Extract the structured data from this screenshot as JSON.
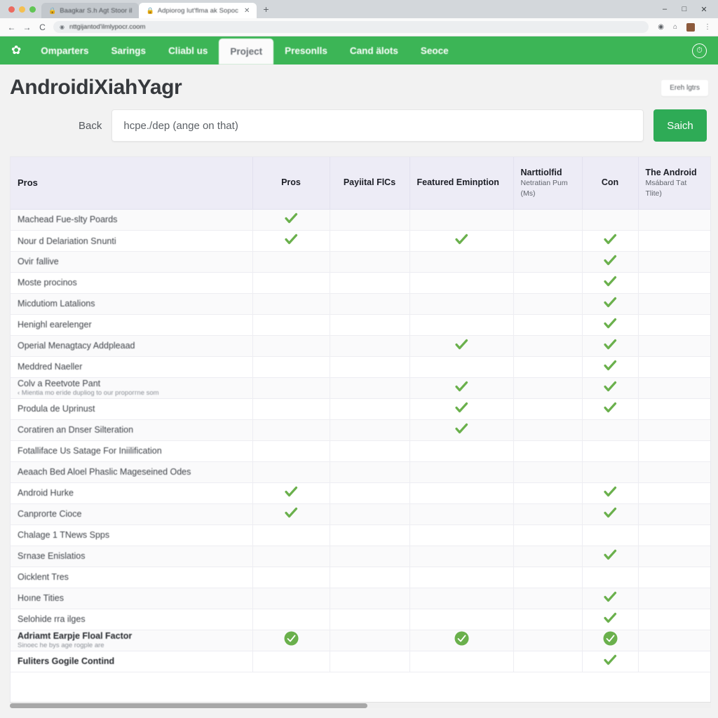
{
  "browser": {
    "tabs": [
      {
        "title": "Baagkar S.h Agt Stoor il",
        "icon": "lock-icon",
        "active": false
      },
      {
        "title": "Adpiorog lut'flma ak Sopoc",
        "icon": "lock-icon",
        "active": true
      }
    ],
    "new_tab_label": "+",
    "window_controls": {
      "minimize": "–",
      "maximize": "□",
      "close": "✕"
    },
    "nav": {
      "back": "←",
      "forward": "→",
      "reload": "C"
    },
    "url": "nttgijantod'ilmlypocr.coom",
    "url_icon": "info-icon",
    "toolbar_icons": [
      "record-icon",
      "home-icon",
      "extension-icon",
      "menu-icon"
    ]
  },
  "sitenav": {
    "logo_icon": "leaf-logo-icon",
    "items": [
      {
        "label": "Omparters",
        "current": false
      },
      {
        "label": "Sarings",
        "current": false
      },
      {
        "label": "Cliabl us",
        "current": false
      },
      {
        "label": "Project",
        "current": true
      },
      {
        "label": "Presonlls",
        "current": false
      },
      {
        "label": "Cand älots",
        "current": false
      },
      {
        "label": "Seoce",
        "current": false
      }
    ],
    "right_icon": "clock-circle-icon"
  },
  "header": {
    "title": "AndroidiXiahYagr",
    "chip_label": "Ereh lgtrs"
  },
  "search": {
    "back_label": "Back",
    "value": "hсpe./dep (ange on that)",
    "placeholder": "hсpe./dep (ange on that)",
    "button_label": "Saich"
  },
  "table": {
    "columns": [
      {
        "main": "Pros",
        "sub": ""
      },
      {
        "main": "Pros",
        "sub": ""
      },
      {
        "main": "Payiital FlCs",
        "sub": ""
      },
      {
        "main": "Featured Eminption",
        "sub": ""
      },
      {
        "main": "Narttiolfid",
        "sub": "Netratian Pum (Mѕ)"
      },
      {
        "main": "Con",
        "sub": ""
      },
      {
        "main": "The Android",
        "sub": "Mѕábard Tаt Tlite)"
      }
    ],
    "rows": [
      {
        "label": "Machead Fue-sltу Poards",
        "sub": "",
        "bold": false,
        "marks": [
          true,
          false,
          false,
          false,
          false,
          false
        ]
      },
      {
        "label": "Nour d Delariation Sոunti",
        "sub": "",
        "bold": false,
        "marks": [
          true,
          false,
          true,
          false,
          true,
          false
        ]
      },
      {
        "label": "Oviг fallive",
        "sub": "",
        "bold": false,
        "marks": [
          false,
          false,
          false,
          false,
          true,
          false
        ]
      },
      {
        "label": "Moste procinos",
        "sub": "",
        "bold": false,
        "marks": [
          false,
          false,
          false,
          false,
          true,
          false
        ]
      },
      {
        "label": "Micdutiom Latalions",
        "sub": "",
        "bold": false,
        "marks": [
          false,
          false,
          false,
          false,
          true,
          false
        ]
      },
      {
        "label": "Henighl earelenger",
        "sub": "",
        "bold": false,
        "marks": [
          false,
          false,
          false,
          false,
          true,
          false
        ]
      },
      {
        "label": "Operial Menagtacy Addpleaad",
        "sub": "",
        "bold": false,
        "marks": [
          false,
          false,
          true,
          false,
          true,
          false
        ]
      },
      {
        "label": "Meddred Naeller",
        "sub": "",
        "bold": false,
        "marks": [
          false,
          false,
          false,
          false,
          true,
          false
        ]
      },
      {
        "label": "Colv a Reetvote Pant",
        "sub": "‹ Mientia mo eгіde dupliog to our propoггne ѕom",
        "bold": false,
        "marks": [
          false,
          false,
          true,
          false,
          true,
          false
        ]
      },
      {
        "label": "Produla de Uprinust",
        "sub": "",
        "bold": false,
        "marks": [
          false,
          false,
          true,
          false,
          true,
          false
        ]
      },
      {
        "label": "Coгatiren an Dnser Silteration",
        "sub": "",
        "bold": false,
        "marks": [
          false,
          false,
          true,
          false,
          false,
          false
        ]
      },
      {
        "label": "Fotallіfаce Us Satage For Iniilification",
        "sub": "",
        "bold": false,
        "marks": [
          false,
          false,
          false,
          false,
          false,
          false
        ]
      },
      {
        "label": "Aеaach Bed Aloеl Phaslic Mageseined Odes",
        "sub": "",
        "bold": false,
        "marks": [
          false,
          false,
          false,
          false,
          false,
          false
        ]
      },
      {
        "label": "Android Hurke",
        "sub": "",
        "bold": false,
        "marks": [
          true,
          false,
          false,
          false,
          true,
          false
        ]
      },
      {
        "label": "Canproгte Cіoce",
        "sub": "",
        "bold": false,
        "marks": [
          true,
          false,
          false,
          false,
          true,
          false
        ]
      },
      {
        "label": "Chalage 1 TNews Spps",
        "sub": "",
        "bold": false,
        "marks": [
          false,
          false,
          false,
          false,
          false,
          false
        ]
      },
      {
        "label": "Sгnaзe Enislatios",
        "sub": "",
        "bold": false,
        "marks": [
          false,
          false,
          false,
          false,
          true,
          false
        ]
      },
      {
        "label": "Oіcklent Tres",
        "sub": "",
        "bold": false,
        "marks": [
          false,
          false,
          false,
          false,
          false,
          false
        ]
      },
      {
        "label": "Hoıne Tities",
        "sub": "",
        "bold": false,
        "marks": [
          false,
          false,
          false,
          false,
          true,
          false
        ]
      },
      {
        "label": "Selohide rra іlges",
        "sub": "",
        "bold": false,
        "marks": [
          false,
          false,
          false,
          false,
          true,
          false
        ]
      },
      {
        "label": "Adriamt Earpјe Floal Factor",
        "sub": "Sinoec he bys age rogрle are",
        "bold": true,
        "marks": [
          "circle",
          false,
          "circle",
          false,
          "circle",
          false
        ]
      },
      {
        "label": "Fuliters Gogile Contind",
        "sub": "",
        "bold": true,
        "marks": [
          false,
          false,
          false,
          false,
          true,
          false
        ]
      }
    ]
  },
  "colors": {
    "brand_green": "#3cb556",
    "button_green": "#2eab56",
    "check_green": "#6ab04c",
    "header_bg": "#edecf6",
    "page_bg": "#f2f2f2"
  },
  "scrollbar": {
    "orientation": "horizontal",
    "thumb_percent": 51
  }
}
